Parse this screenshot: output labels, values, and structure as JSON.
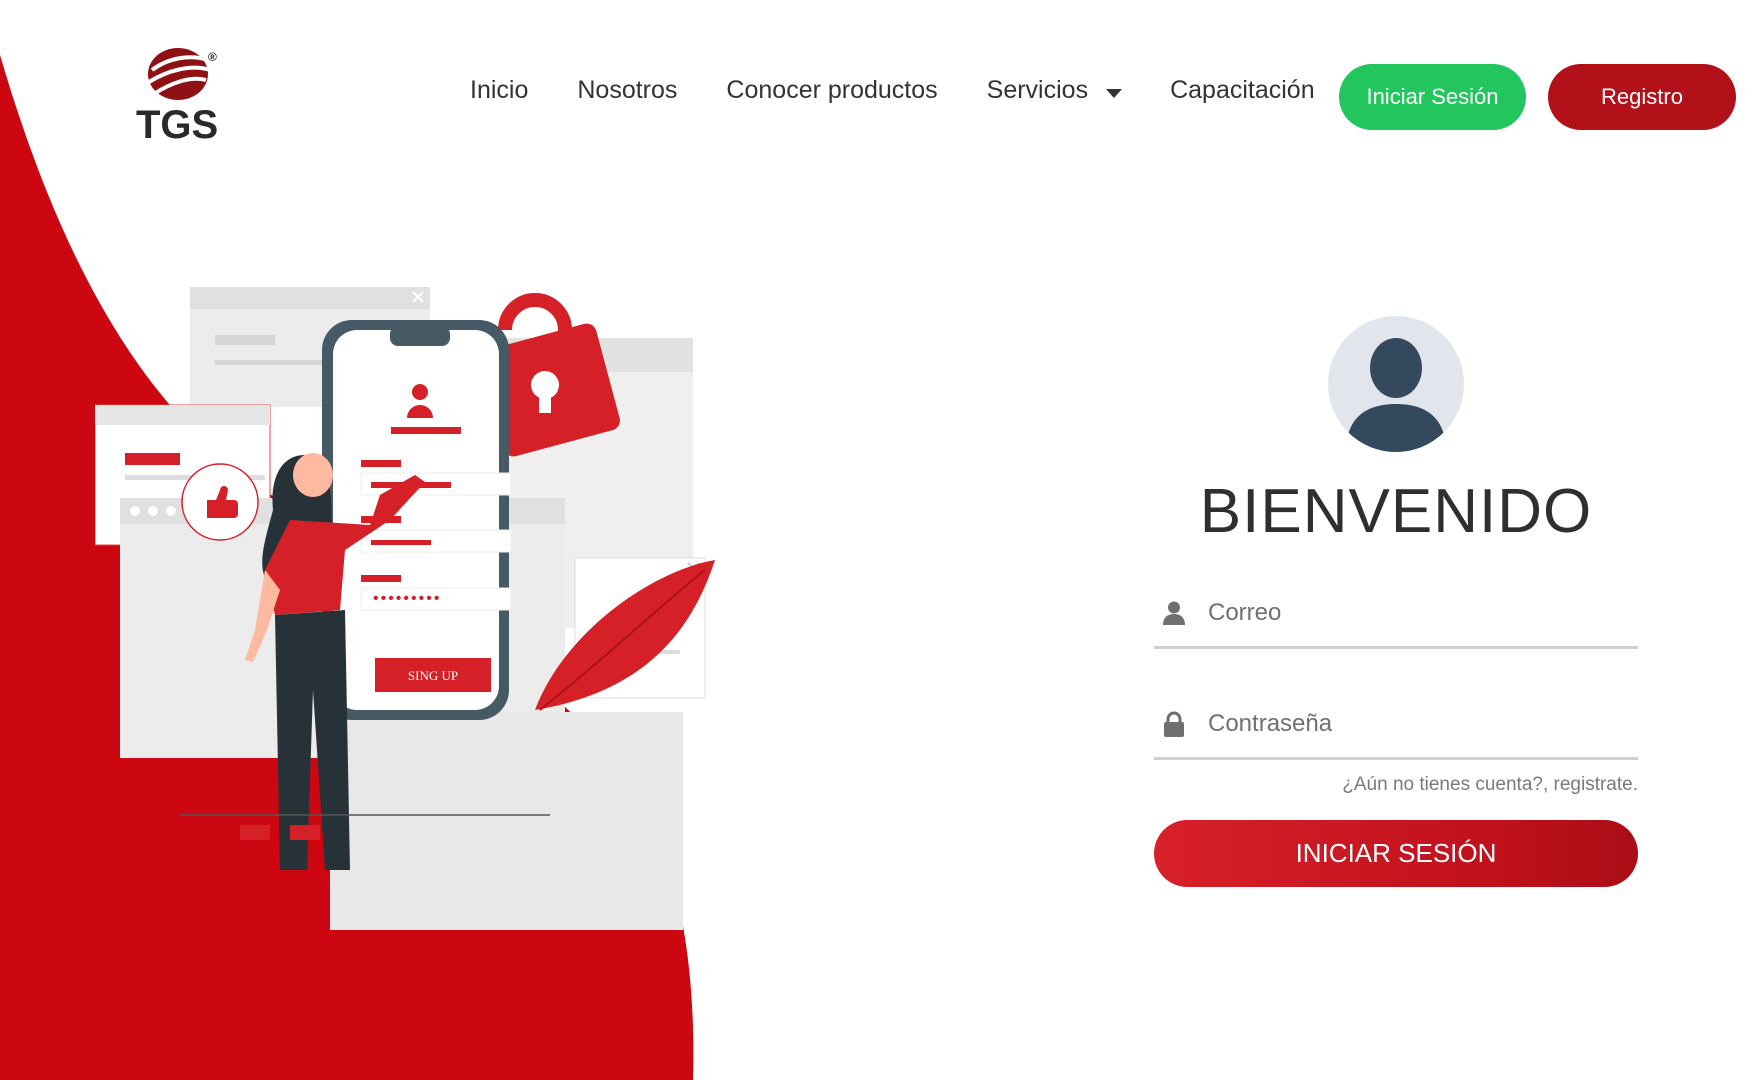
{
  "brand": {
    "logo_text": "TGS",
    "registered_mark": "®"
  },
  "nav": {
    "items": [
      "Inicio",
      "Nosotros",
      "Conocer productos",
      "Servicios",
      "Capacitación"
    ]
  },
  "header_buttons": {
    "login": "Iniciar Sesión",
    "register": "Registro"
  },
  "illustration": {
    "button_label": "SING UP"
  },
  "login": {
    "title": "BIENVENIDO",
    "email_placeholder": "Correo",
    "password_placeholder": "Contraseña",
    "signup_prompt": "¿Aún no tienes cuenta?, registrate.",
    "submit_label": "INICIAR SESIÓN"
  },
  "colors": {
    "brand_red": "#c8111b",
    "green": "#22c55e",
    "dark_red": "#b3111a"
  }
}
